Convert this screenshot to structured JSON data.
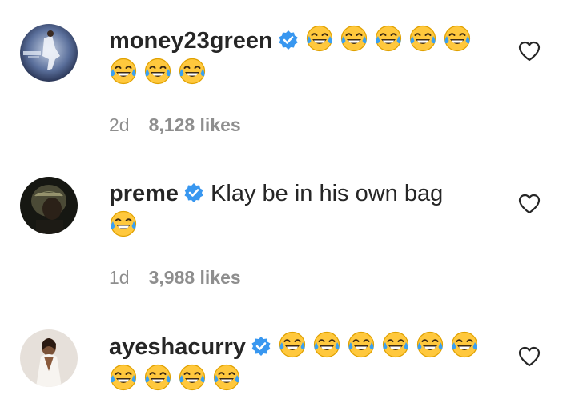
{
  "comments": [
    {
      "username": "money23green",
      "verified": true,
      "text": "",
      "emoji": [
        "face-with-tears-of-joy",
        "face-with-tears-of-joy",
        "face-with-tears-of-joy",
        "face-with-tears-of-joy",
        "face-with-tears-of-joy",
        "face-with-tears-of-joy",
        "face-with-tears-of-joy",
        "face-with-tears-of-joy"
      ],
      "time": "2d",
      "likes": "8,128 likes",
      "avatar_icon": "basketball-player-avatar"
    },
    {
      "username": "preme",
      "verified": true,
      "text": "Klay be in his own bag",
      "emoji": [
        "face-with-tears-of-joy"
      ],
      "time": "1d",
      "likes": "3,988 likes",
      "avatar_icon": "hooded-man-avatar"
    },
    {
      "username": "ayeshacurry",
      "verified": true,
      "text": "",
      "emoji": [
        "face-with-tears-of-joy",
        "face-with-tears-of-joy",
        "face-with-tears-of-joy",
        "face-with-tears-of-joy",
        "face-with-tears-of-joy",
        "face-with-tears-of-joy",
        "face-with-tears-of-joy",
        "face-with-tears-of-joy",
        "face-with-tears-of-joy",
        "face-with-tears-of-joy"
      ],
      "time": "",
      "likes": "",
      "avatar_icon": "woman-in-white-avatar"
    }
  ],
  "colors": {
    "text": "#262626",
    "meta": "#8e8e8e",
    "verified_blue": "#3897f0",
    "emoji_yellow": "#ffc83d",
    "tear_blue": "#3aa0f0"
  }
}
